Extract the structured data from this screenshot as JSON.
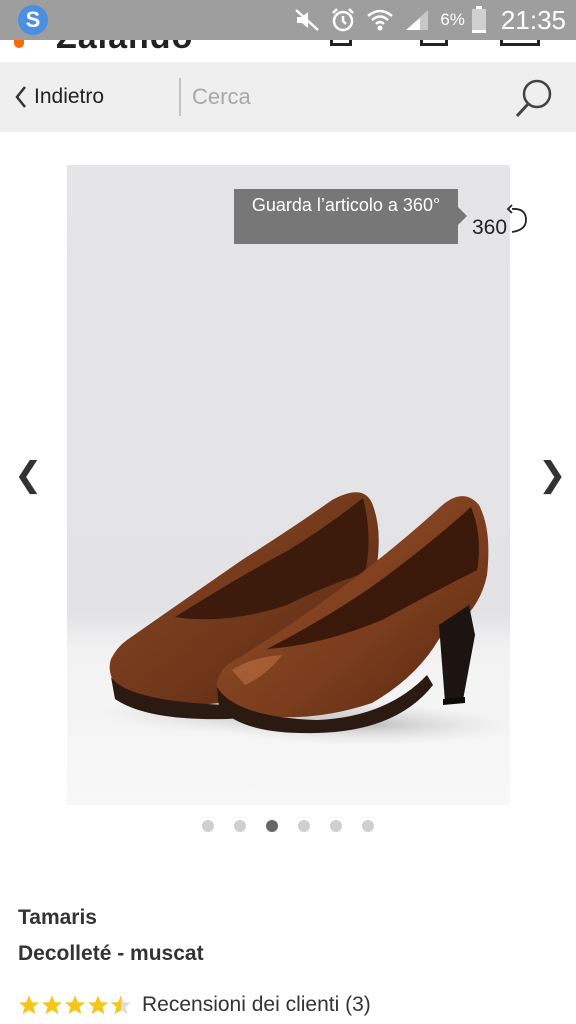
{
  "status_bar": {
    "app_icon_letter": "S",
    "battery_percent": "6%",
    "time": "21:35"
  },
  "header": {
    "brand_logo": "Zalando"
  },
  "search_bar": {
    "back_label": "Indietro",
    "search_placeholder": "Cerca"
  },
  "product_gallery": {
    "hint_text": "Guarda l’articolo a 360°",
    "rotate_label": "360",
    "prev_arrow": "❮",
    "next_arrow": "❯",
    "dot_count": 6,
    "active_dot_index": 2
  },
  "product": {
    "brand": "Tamaris",
    "name": "Decolleté - muscat",
    "rating_stars": 4.5,
    "reviews_label": "Recensioni dei clienti (3)"
  },
  "colors": {
    "status_bar": "#9e9e9e",
    "brand_orange": "#ff6900",
    "star_yellow": "#f5c518",
    "shoe_brown": "#7b3d1e"
  }
}
